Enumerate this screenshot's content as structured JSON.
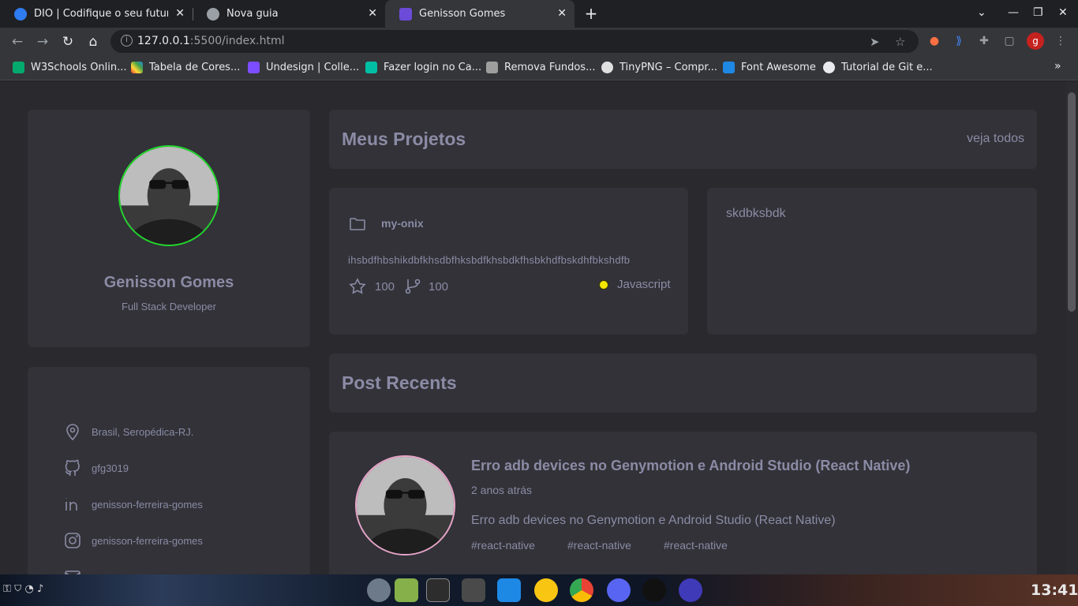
{
  "browser": {
    "tabs": [
      {
        "title": "DIO | Codifique o seu futuro g",
        "icon": "dio-icon"
      },
      {
        "title": "Nova guia",
        "icon": "chrome-icon"
      },
      {
        "title": "Genisson Gomes",
        "icon": "page-icon"
      }
    ],
    "url_host": "127.0.0.1",
    "url_path": ":5500/index.html",
    "profile_initial": "g",
    "bookmarks": [
      "W3Schools Onlin...",
      "Tabela de Cores...",
      "Undesign | Colle...",
      "Fazer login no Ca...",
      "Remova Fundos...",
      "TinyPNG – Compr...",
      "Font Awesome",
      "Tutorial de Git e..."
    ]
  },
  "profile": {
    "name": "Genisson Gomes",
    "role": "Full Stack Developer"
  },
  "info": {
    "location": "Brasil, Seropédica-RJ.",
    "github": "gfg3019",
    "linkedin": "genisson-ferreira-gomes",
    "instagram": "genisson-ferreira-gomes"
  },
  "projects": {
    "title": "Meus Projetos",
    "view_all": "veja todos",
    "repos": [
      {
        "name": "my-onix",
        "description": "ihsbdfhbshikdbfkhsdbfhksbdfkhsbdkfhsbkhdfbskdhfbkshdfb",
        "stars": "100",
        "forks": "100",
        "language": "Javascript"
      },
      {
        "name": "skdbksbdk"
      }
    ]
  },
  "posts": {
    "title": "Post Recents",
    "items": [
      {
        "title": "Erro adb devices no Genymotion e Android Studio (React Native)",
        "date": "2 anos atrás",
        "body": "Erro adb devices no Genymotion e Android Studio (React Native)",
        "tags": [
          "#react-native",
          "#react-native",
          "#react-native"
        ]
      }
    ]
  },
  "taskbar": {
    "clock": "13:41"
  },
  "colors": {
    "page_bg": "#29292e",
    "card_bg": "#323238",
    "text": "#8b8ba6",
    "avatar_ring_profile": "#1fd72a",
    "avatar_ring_post": "#e7a3c9",
    "language_dot": "#f5e600"
  }
}
